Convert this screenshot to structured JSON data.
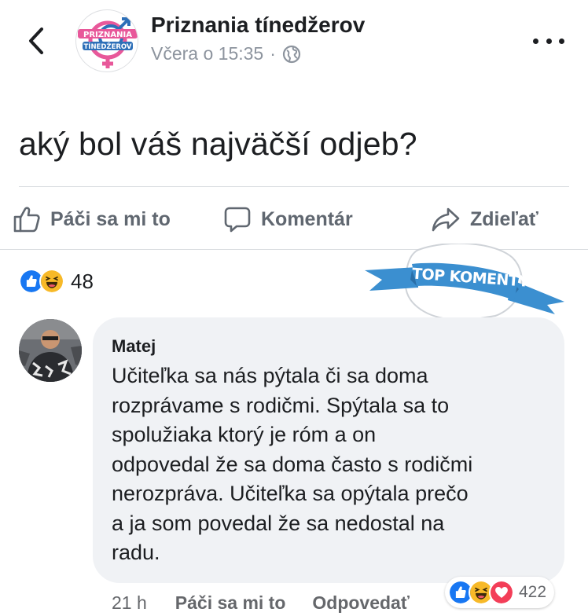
{
  "header": {
    "page_name": "Priznania tínedžerov",
    "timestamp": "Včera o 15:35",
    "separator": "·",
    "privacy_icon": "globe-icon",
    "back_icon": "chevron-left-icon",
    "more_icon": "more-horizontal-icon",
    "logo_text_top": "PRIZNANIA",
    "logo_text_bottom": "TÍNEDŽEROV"
  },
  "post": {
    "text": "aký bol váš najväčší odjeb?"
  },
  "actions": {
    "like_label": "Páči sa mi to",
    "comment_label": "Komentár",
    "share_label": "Zdieľať"
  },
  "reactions": {
    "types": [
      "like",
      "haha"
    ],
    "count": "48"
  },
  "badge": {
    "label": "TOP KOMENTY"
  },
  "comment": {
    "author": "Matej",
    "lines": [
      "Učiteľka sa nás pýtala či sa doma",
      "rozprávame s rodičmi. Spýtala sa to",
      "spolužiaka ktorý je róm a on",
      "odpovedal že sa doma často s rodičmi",
      "nerozpráva. Učiteľka sa opýtala prečo",
      "a ja som povedal že sa nedostal na",
      "radu."
    ],
    "time": "21 h",
    "like_label": "Páči sa mi to",
    "reply_label": "Odpovedať",
    "reaction_types": [
      "like",
      "haha",
      "love"
    ],
    "reaction_count": "422"
  },
  "colors": {
    "like_blue": "#1877f2",
    "haha_yellow": "#f7b928",
    "love_red": "#f33e58",
    "badge_blue": "#3b8fd0",
    "muted_text": "#606770"
  }
}
